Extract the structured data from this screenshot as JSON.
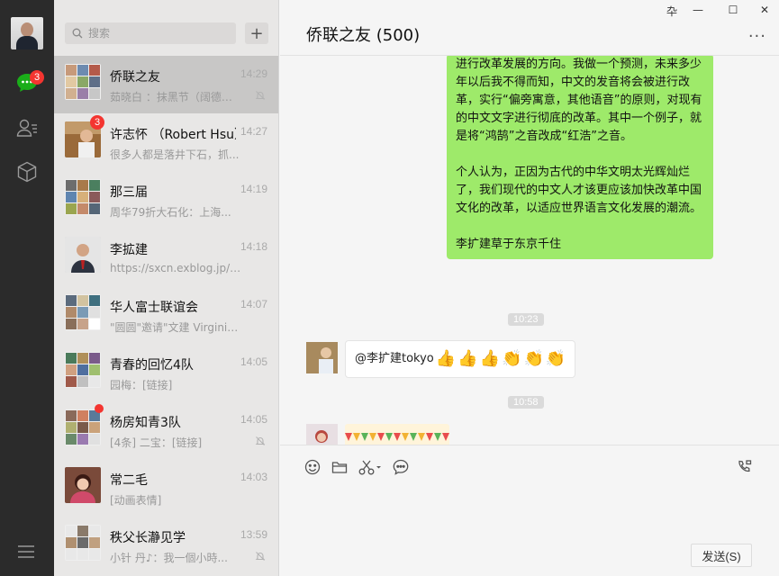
{
  "rail": {
    "chat_badge": "3"
  },
  "search": {
    "placeholder": "搜索",
    "add_label": "+"
  },
  "chats": [
    {
      "name": "侨联之友",
      "time": "14:29",
      "snippet": "茹晓白 ：抹黑节（阔德格...",
      "muted": true,
      "active": true
    },
    {
      "name": "许志怀 （Robert Hsu）",
      "time": "14:27",
      "snippet": "很多人都是落井下石，抓...",
      "badge": "3"
    },
    {
      "name": "那三届",
      "time": "14:19",
      "snippet": "周华79折大石化：上海..."
    },
    {
      "name": "李拡建",
      "time": "14:18",
      "snippet": "https://sxcn.exblog.jp/2..."
    },
    {
      "name": "华人富士联谊会",
      "time": "14:07",
      "snippet": "\"圆圆\"邀请\"文建 Virginie..."
    },
    {
      "name": "青春的回忆4队",
      "time": "14:05",
      "snippet": "园梅：[链接]"
    },
    {
      "name": "杨房知青3队",
      "time": "14:05",
      "snippet": "[4条] 二宝：[链接]",
      "muted": true,
      "dot": true
    },
    {
      "name": "常二毛",
      "time": "14:03",
      "snippet": "[动画表情]"
    },
    {
      "name": "秩父长瀞见学",
      "time": "13:59",
      "snippet": "小针 丹♪：我一個小時...",
      "muted": true
    }
  ],
  "chat": {
    "title": "侨联之友 (500)",
    "more": "···",
    "window_controls": [
      "卆",
      "—",
      "☐",
      "✕"
    ],
    "green_bubble": {
      "p1": "进行改革发展的方向。我做一个预测，未来多少年以后我不得而知，中文的发音将会被进行改革，实行“偏旁寓意，其他语音”的原则，对现有的中文文字进行彻底的改革。其中一个例子，就是将“鸿鹄”之音改成“红浩”之音。",
      "p2": "个人认为，正因为古代的中华文明太光辉灿烂了，我们现代的中文人才该更应该加快改革中国文化的改革，以适应世界语言文化发展的潮流。",
      "p3": "李扩建草于东京千住"
    },
    "timestamp1": "10:23",
    "mention_text": "@李扩建tokyo",
    "timestamp2": "10:58"
  },
  "composer": {
    "send_label": "发送(S)"
  },
  "colors": {
    "green_bubble": "#9eea6a",
    "badge": "#f43530",
    "rail": "#2b2b2b"
  }
}
